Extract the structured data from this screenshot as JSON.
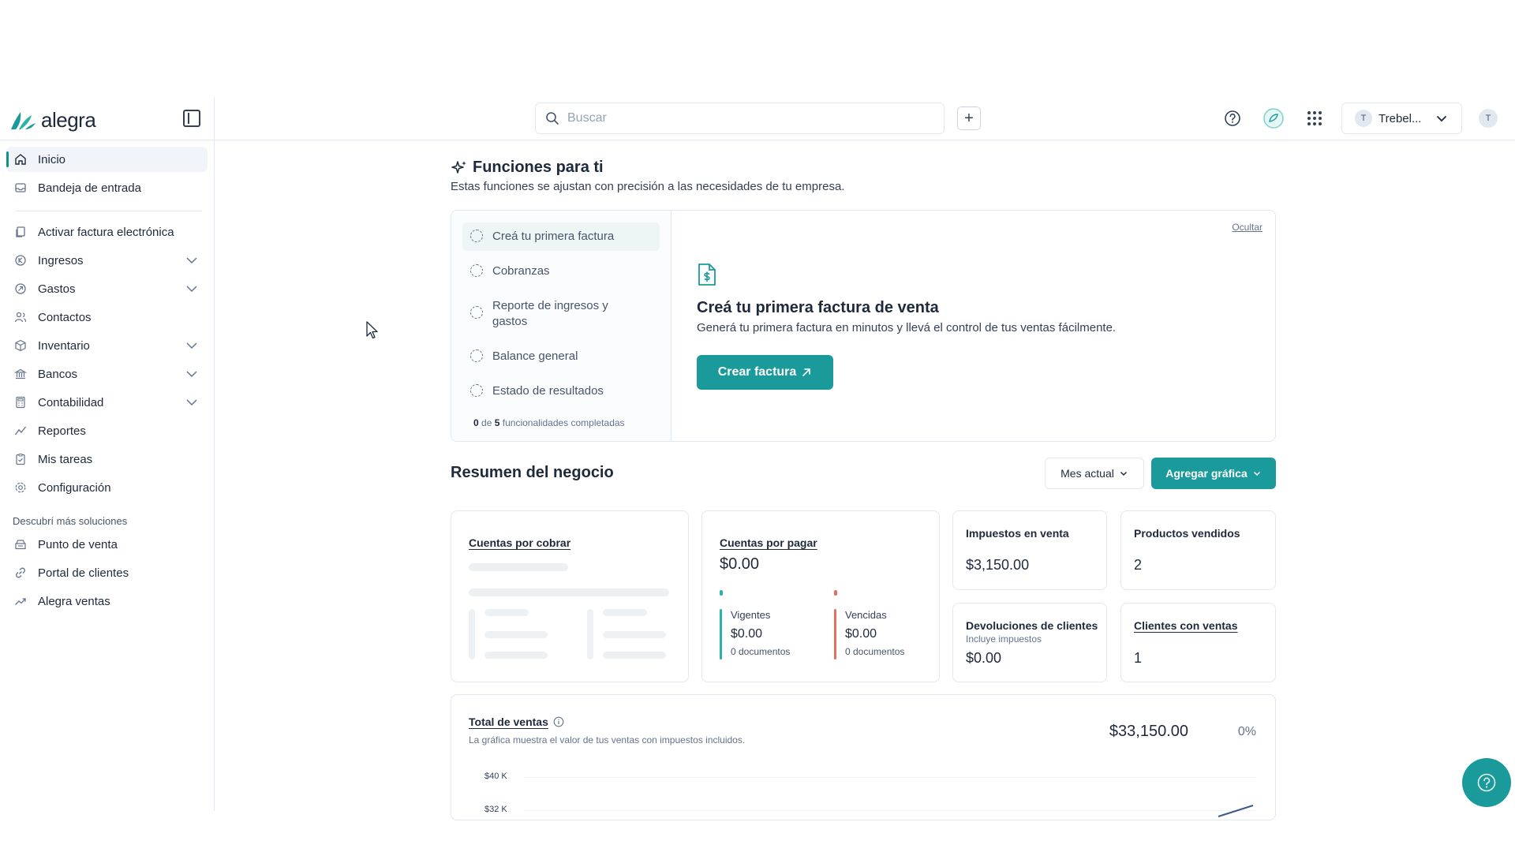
{
  "header": {
    "logo_text": "alegra",
    "search_placeholder": "Buscar",
    "company_initial": "T",
    "company_name": "Trebel...",
    "user_initial": "T",
    "icons": [
      "help-circle-icon",
      "assistant-icon",
      "apps-grid-icon"
    ]
  },
  "sidebar": {
    "items": [
      {
        "label": "Inicio",
        "icon": "home-icon",
        "active": true
      },
      {
        "label": "Bandeja de entrada",
        "icon": "inbox-icon"
      },
      {
        "label": "Activar factura electrónica",
        "icon": "document-copy-icon"
      },
      {
        "label": "Ingresos",
        "icon": "income-icon",
        "expandable": true
      },
      {
        "label": "Gastos",
        "icon": "expense-icon",
        "expandable": true
      },
      {
        "label": "Contactos",
        "icon": "contacts-icon"
      },
      {
        "label": "Inventario",
        "icon": "box-icon",
        "expandable": true
      },
      {
        "label": "Bancos",
        "icon": "bank-icon",
        "expandable": true
      },
      {
        "label": "Contabilidad",
        "icon": "calculator-icon",
        "expandable": true
      },
      {
        "label": "Reportes",
        "icon": "chart-line-icon"
      },
      {
        "label": "Mis tareas",
        "icon": "clipboard-icon"
      },
      {
        "label": "Configuración",
        "icon": "gear-icon"
      }
    ],
    "section_label": "Descubrí más soluciones",
    "solutions": [
      {
        "label": "Punto de venta",
        "icon": "pos-icon"
      },
      {
        "label": "Portal de clientes",
        "icon": "link-icon"
      },
      {
        "label": "Alegra ventas",
        "icon": "trend-icon"
      }
    ]
  },
  "features": {
    "title": "Funciones para ti",
    "subtitle": "Estas funciones se ajustan con precisión a las necesidades de tu empresa.",
    "steps": [
      "Creá tu primera factura",
      "Cobranzas",
      "Reporte de ingresos y gastos",
      "Balance general",
      "Estado de resultados"
    ],
    "progress_done": "0",
    "progress_of": "de",
    "progress_total": "5",
    "progress_label": "funcionalidades completadas",
    "hide_label": "Ocultar",
    "card_title": "Creá tu primera factura de venta",
    "card_desc": "Generá tu primera factura en minutos y llevá el control de tus ventas fácilmente.",
    "cta_label": "Crear factura"
  },
  "summary": {
    "title": "Resumen del negocio",
    "period_label": "Mes actual",
    "add_chart_label": "Agregar gráfica",
    "cuentas_cobrar_title": "Cuentas por cobrar",
    "cuentas_pagar": {
      "title": "Cuentas por pagar",
      "total": "$0.00",
      "vigentes_label": "Vigentes",
      "vigentes_value": "$0.00",
      "vigentes_docs": "0 documentos",
      "vencidas_label": "Vencidas",
      "vencidas_value": "$0.00",
      "vencidas_docs": "0 documentos"
    },
    "impuestos": {
      "title": "Impuestos en venta",
      "value": "$3,150.00"
    },
    "productos": {
      "title": "Productos vendidos",
      "value": "2"
    },
    "devoluciones": {
      "title": "Devoluciones de clientes",
      "sub": "Incluye impuestos",
      "value": "$0.00"
    },
    "clientes": {
      "title": "Clientes con ventas",
      "value": "1"
    }
  },
  "ventas": {
    "title": "Total de ventas",
    "subtitle": "La gráfica muestra el valor de tus ventas con impuestos incluidos.",
    "total": "$33,150.00",
    "change": "0%",
    "ticks": [
      "$40 K",
      "$32 K"
    ]
  },
  "colors": {
    "accent": "#1a9a9a",
    "vigentes": "#2bb3a8",
    "vencidas": "#e0735f"
  }
}
